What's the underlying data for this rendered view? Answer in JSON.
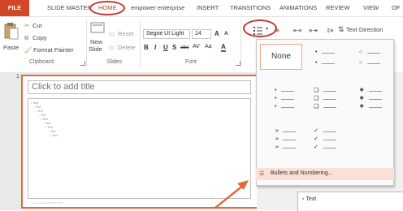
{
  "tabs": [
    "FILE",
    "SLIDE MASTER",
    "HOME",
    "empower enterprise",
    "INSERT",
    "TRANSITIONS",
    "ANIMATIONS",
    "REVIEW",
    "VIEW",
    "OF"
  ],
  "clipboard": {
    "paste": "Paste",
    "cut": "Cut",
    "copy": "Copy",
    "format_painter": "Format Painter",
    "label": "Clipboard"
  },
  "slides": {
    "new_slide_1": "New",
    "new_slide_2": "Slide",
    "reset": "Reset",
    "delete": "Delete",
    "label": "Slides"
  },
  "font": {
    "name": "Segoe UI Light",
    "size": "14",
    "grow": "A",
    "shrink": "A",
    "bold": "B",
    "italic": "I",
    "underline": "U",
    "strike": "S",
    "spacing": "abc",
    "case": "Aa",
    "color": "A",
    "label": "Font"
  },
  "paragraph": {
    "text_direction": "Text Direction"
  },
  "slide": {
    "number": "1",
    "title_placeholder": "Click to add title",
    "bullets": [
      "• Text",
      "– Text",
      "• Text",
      "– Text",
      "• Text",
      "– Text",
      "• Text",
      "– Text",
      "• Text"
    ],
    "footer": "Source: Microsoft Office 2013"
  },
  "bullet_gallery": {
    "none_label": "None",
    "menu_item": "Bullets and Numbering..."
  },
  "right_pane": {
    "bullet_text": "Text"
  },
  "colors": {
    "accent": "#d24726",
    "highlight": "#c0392b",
    "hover": "#fbe0d6"
  },
  "icons": [
    "cut-icon",
    "copy-icon",
    "paste-icon",
    "format-painter-icon",
    "bullets-icon",
    "numbering-icon",
    "text-direction-icon",
    "bullets-numbering-icon"
  ]
}
